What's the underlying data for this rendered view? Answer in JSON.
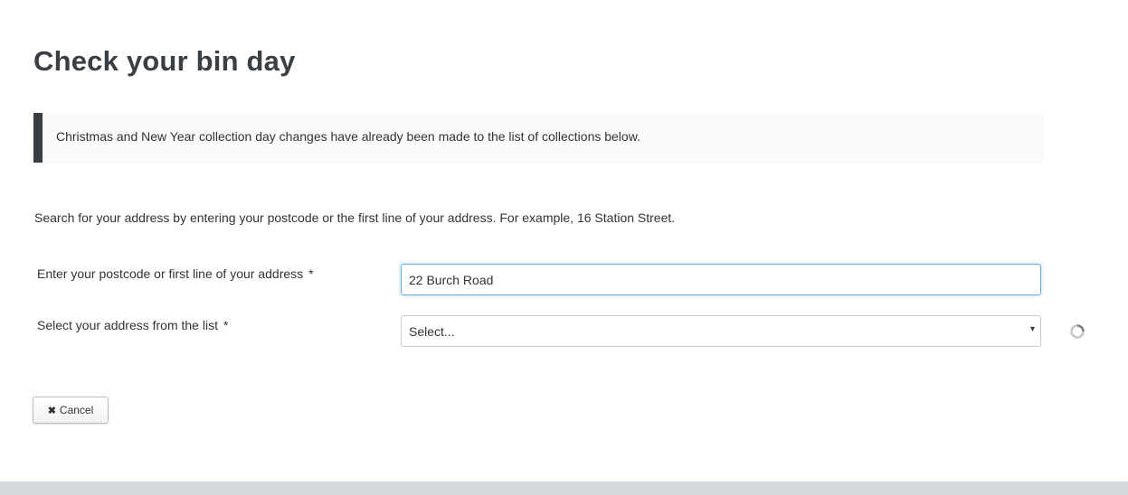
{
  "page": {
    "title": "Check your bin day"
  },
  "notice": {
    "text": "Christmas and New Year collection day changes have already been made to the list of collections below.",
    "accent_color": "#3a3f44"
  },
  "instructions": "Search for your address by entering your postcode or the first line of your address. For example, 16 Station Street.",
  "form": {
    "postcode_label": "Enter your postcode or first line of your address",
    "postcode_required": "*",
    "postcode_value": "22 Burch Road",
    "address_label": "Select your address from the list",
    "address_required": "*",
    "address_selected": "Select...",
    "address_arrow": "▾",
    "loading_icon": "spinner-icon"
  },
  "actions": {
    "cancel_icon": "✖",
    "cancel_label": "Cancel"
  }
}
